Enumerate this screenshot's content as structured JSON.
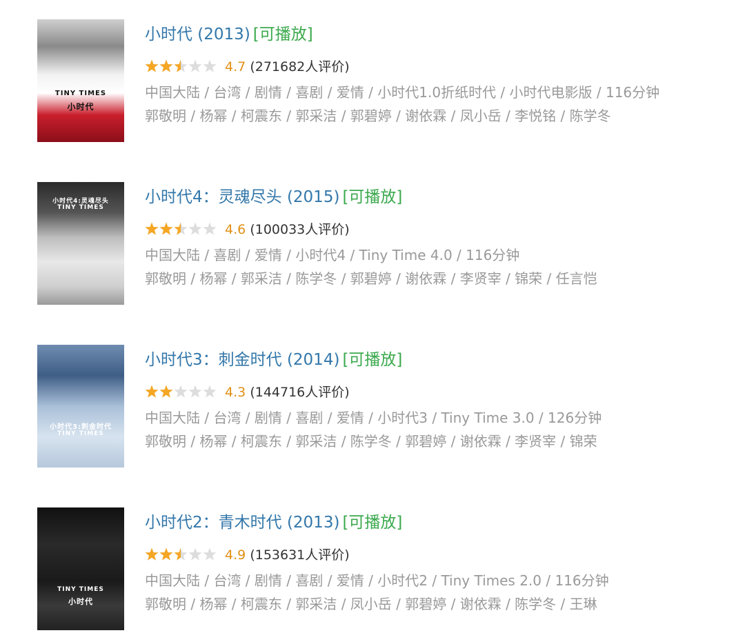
{
  "colors": {
    "title_link": "#3377aa",
    "playable": "#3ba94d",
    "score": "#e09015",
    "star_filled": "#f5a623",
    "star_empty": "#dddddd",
    "meta": "#999999"
  },
  "movies": [
    {
      "title": "小时代 (2013)",
      "playable_label": "[可播放]",
      "stars": 2.5,
      "score": "4.7",
      "votes": "(271682人评价)",
      "meta": "中国大陆 / 台湾 / 剧情 / 喜剧 / 爱情 / 小时代1.0折纸时代 / 小时代电影版 / 116分钟",
      "cast": "郭敬明 / 杨幂 / 柯震东 / 郭采洁 / 郭碧婷 / 谢依霖 / 凤小岳 / 李悦铭 / 陈学冬",
      "poster_text": [
        "TINY TIMES",
        "小时代"
      ]
    },
    {
      "title": "小时代4：灵魂尽头 (2015)",
      "playable_label": "[可播放]",
      "stars": 2.5,
      "score": "4.6",
      "votes": "(100033人评价)",
      "meta": "中国大陆 / 喜剧 / 爱情 / 小时代4 / Tiny Time 4.0 / 116分钟",
      "cast": "郭敬明 / 杨幂 / 郭采洁 / 陈学冬 / 郭碧婷 / 谢依霖 / 李贤宰 / 锦荣 / 任言恺",
      "poster_text": [
        "小时代4:灵魂尽头",
        "TINY TIMES"
      ]
    },
    {
      "title": "小时代3：刺金时代 (2014)",
      "playable_label": "[可播放]",
      "stars": 2,
      "score": "4.3",
      "votes": "(144716人评价)",
      "meta": "中国大陆 / 台湾 / 剧情 / 喜剧 / 爱情 / 小时代3 / Tiny Time 3.0 / 126分钟",
      "cast": "郭敬明 / 杨幂 / 柯震东 / 郭采洁 / 陈学冬 / 郭碧婷 / 谢依霖 / 李贤宰 / 锦荣",
      "poster_text": [
        "小时代3:刺金时代",
        "TINY TIMES"
      ]
    },
    {
      "title": "小时代2：青木时代 (2013)",
      "playable_label": "[可播放]",
      "stars": 2.5,
      "score": "4.9",
      "votes": "(153631人评价)",
      "meta": "中国大陆 / 台湾 / 剧情 / 喜剧 / 爱情 / 小时代2 / Tiny Times 2.0 / 116分钟",
      "cast": "郭敬明 / 杨幂 / 柯震东 / 郭采洁 / 凤小岳 / 郭碧婷 / 谢依霖 / 陈学冬 / 王琳",
      "poster_text": [
        "TINY TIMES",
        "小时代"
      ]
    }
  ]
}
